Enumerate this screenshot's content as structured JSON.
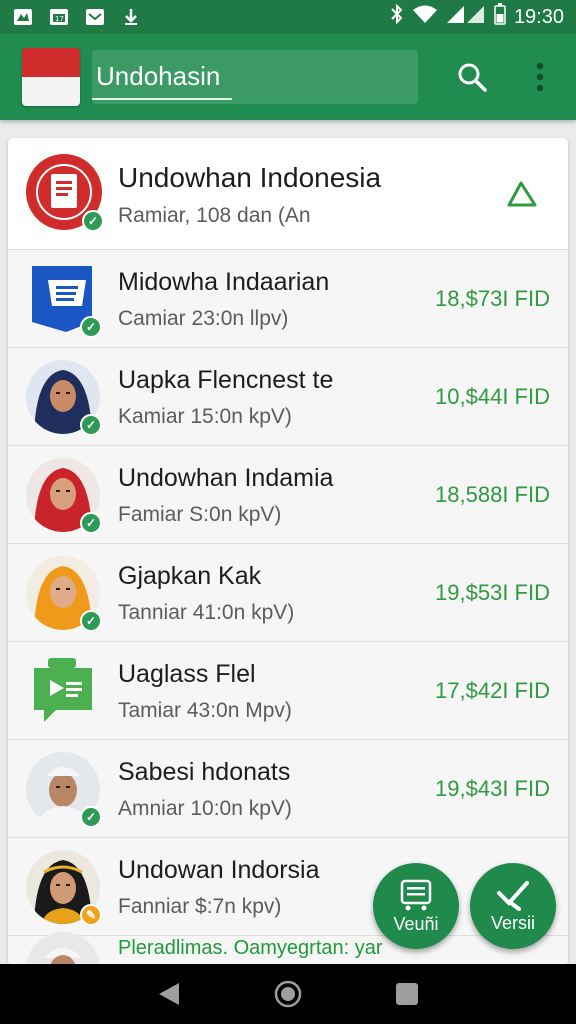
{
  "status_bar": {
    "time": "19:30"
  },
  "app_bar": {
    "search_value": "Undohasin",
    "search_placeholder": "Undohasin"
  },
  "header_item": {
    "name": "Undowhan Indonesia",
    "subtitle": "Ramiar, 108 dan (An"
  },
  "items": [
    {
      "name": "Midowha Indaarian",
      "subtitle": "Camiar 23:0n llpv)",
      "amount": "18,$73I FID",
      "avatar": "document-icon"
    },
    {
      "name": "Uapka Flencnest te",
      "subtitle": "Kamiar 15:0n kpV)",
      "amount": "10,$44I FID",
      "avatar": "person-hijab-navy"
    },
    {
      "name": "Undowhan Indamia",
      "subtitle": "Famiar S:0n kpV)",
      "amount": "18,588I FID",
      "avatar": "person-hijab-red"
    },
    {
      "name": "Gjapkan Kak",
      "subtitle": "Tanniar 41:0n kpV)",
      "amount": "19,$53I FID",
      "avatar": "person-hijab-orange"
    },
    {
      "name": "Uaglass Flel",
      "subtitle": "Tamiar 43:0n Mpv)",
      "amount": "17,$42I FID",
      "avatar": "chat-icon"
    },
    {
      "name": "Sabesi hdonats",
      "subtitle": "Amniar 10:0n kpV)",
      "amount": "19,$43I FID",
      "avatar": "person-cap"
    },
    {
      "name": "Undowan Indorsia",
      "subtitle": "Fanniar $:7n kpv)",
      "amount": "",
      "avatar": "person-headscarf"
    }
  ],
  "promo_text": "Pleradlimas. Oamyegrtan: yar",
  "fabs": {
    "left_label": "Veuñi",
    "right_label": "Versii"
  },
  "colors": {
    "primary": "#218c50",
    "status_bar": "#1f7a45",
    "amount": "#2f9a3f",
    "check": "#2f9a55"
  }
}
